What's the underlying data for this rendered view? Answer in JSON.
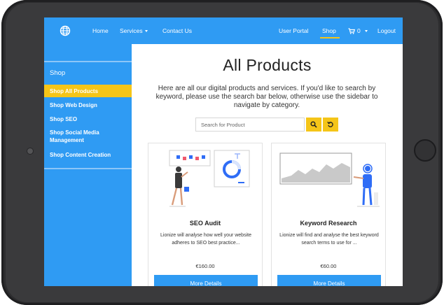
{
  "navbar": {
    "logo_icon": "globe-icon",
    "home": "Home",
    "services": "Services",
    "contact": "Contact Us",
    "user_portal": "User Portal",
    "shop": "Shop",
    "cart_count": "0",
    "cart_icon": "cart-icon",
    "logout": "Logout"
  },
  "sidebar": {
    "heading": "Shop",
    "items": [
      {
        "label": "Shop All Products",
        "active": true
      },
      {
        "label": "Shop Web Design",
        "active": false
      },
      {
        "label": "Shop SEO",
        "active": false
      },
      {
        "label": "Shop Social Media Management",
        "active": false
      },
      {
        "label": "Shop Content Creation",
        "active": false
      }
    ]
  },
  "main": {
    "title": "All Products",
    "intro": "Here are all our digital products and services. If you'd like to search by keyword, please use the search bar below, otherwise use the sidebar to navigate by category.",
    "search": {
      "placeholder": "Search for Product",
      "search_icon": "search-icon",
      "reset_icon": "reset-icon"
    }
  },
  "products": [
    {
      "title": "SEO Audit",
      "description": "Lionize will analyse how well your website adheres to SEO best practice...",
      "price": "€160.00",
      "button": "More Details",
      "illustration": "seo-audit-illustration"
    },
    {
      "title": "Keyword Research",
      "description": "Lionize will find and analyse the best keyword search terms to use for ...",
      "price": "€60.00",
      "button": "More Details",
      "illustration": "keyword-research-illustration"
    }
  ],
  "colors": {
    "primary": "#2f9bf3",
    "accent": "#f5c518",
    "device": "#2d2d2f"
  }
}
